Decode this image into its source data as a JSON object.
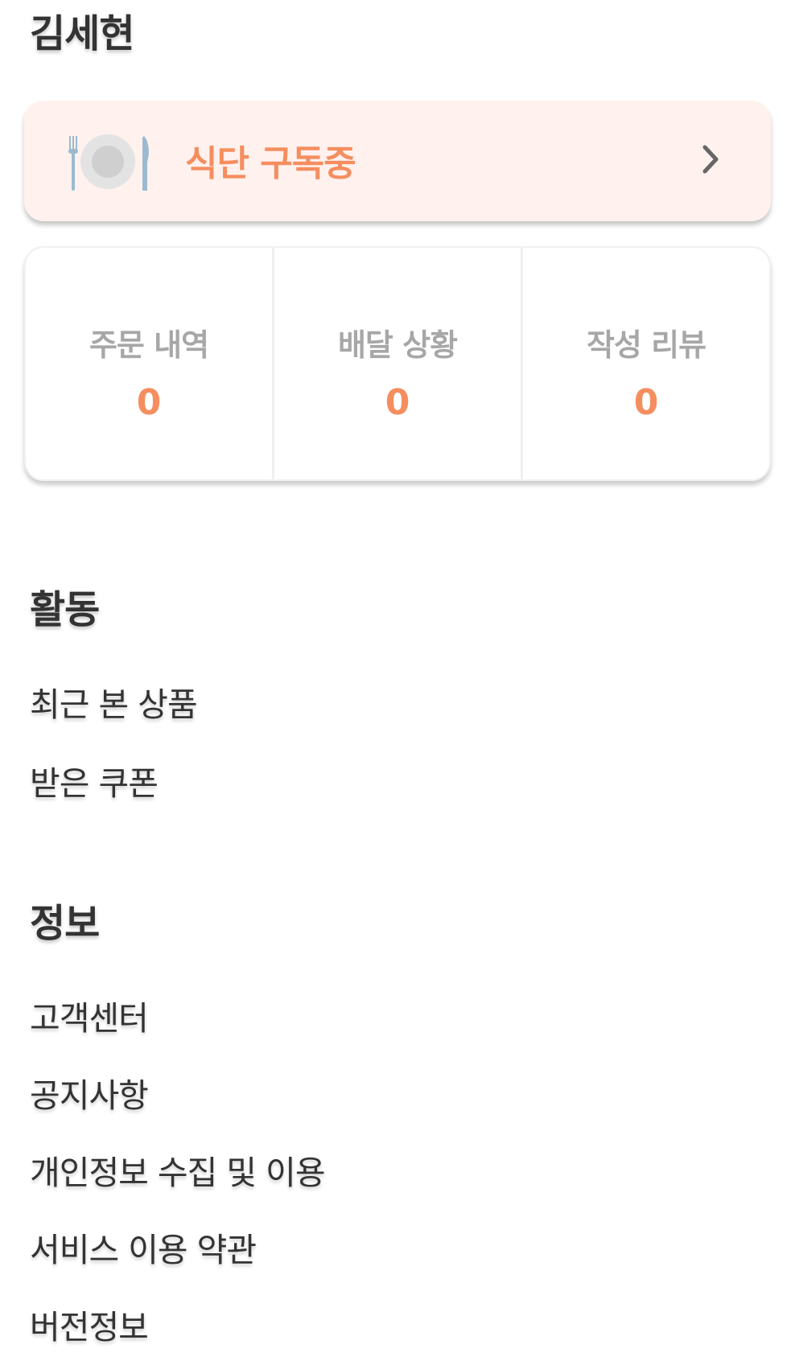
{
  "user": {
    "name": "김세현"
  },
  "subscription": {
    "label": "식단 구독중",
    "icon": "plate-fork-knife-icon",
    "chevron_icon": "chevron-right-icon"
  },
  "stats": [
    {
      "label": "주문 내역",
      "value": "0"
    },
    {
      "label": "배달 상황",
      "value": "0"
    },
    {
      "label": "작성 리뷰",
      "value": "0"
    }
  ],
  "sections": {
    "activity": {
      "title": "활동",
      "items": [
        "최근 본 상품",
        "받은 쿠폰"
      ]
    },
    "info": {
      "title": "정보",
      "items": [
        "고객센터",
        "공지사항",
        "개인정보 수집 및 이용",
        "서비스 이용 약관",
        "버전정보"
      ]
    }
  },
  "colors": {
    "accent": "#f58e5f",
    "card_bg": "#fff1ee",
    "label_gray": "#a7a7a7",
    "text": "#333333"
  }
}
